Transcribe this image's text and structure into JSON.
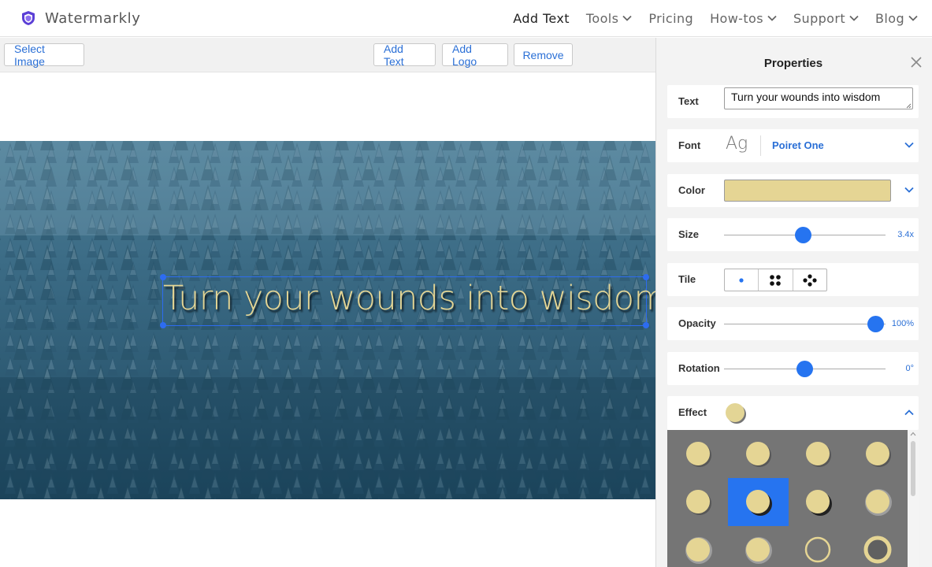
{
  "brand": {
    "name": "Watermarkly",
    "logo_icon": "shield-icon",
    "logo_color": "#5b3fd6"
  },
  "nav": {
    "items": [
      {
        "label": "Add Text",
        "dropdown": false,
        "active": true
      },
      {
        "label": "Tools",
        "dropdown": true,
        "active": false
      },
      {
        "label": "Pricing",
        "dropdown": false,
        "active": false
      },
      {
        "label": "How-tos",
        "dropdown": true,
        "active": false
      },
      {
        "label": "Support",
        "dropdown": true,
        "active": false
      },
      {
        "label": "Blog",
        "dropdown": true,
        "active": false
      }
    ]
  },
  "toolbar": {
    "select_image": "Select Image",
    "add_text": "Add Text",
    "add_logo": "Add Logo",
    "remove": "Remove"
  },
  "canvas": {
    "watermark_text": "Turn your wounds into wisdom",
    "watermark_color": "#e3d595"
  },
  "panel": {
    "title": "Properties",
    "text": {
      "label": "Text",
      "value": "Turn your wounds into wisdom"
    },
    "font": {
      "label": "Font",
      "sample": "Ag",
      "name": "Poiret One"
    },
    "color": {
      "label": "Color",
      "value": "#e5d594"
    },
    "size": {
      "label": "Size",
      "value_text": "3.4x",
      "fraction": 0.49
    },
    "tile": {
      "label": "Tile",
      "options": [
        "single-dot-icon",
        "four-dots-icon",
        "scattered-dots-icon"
      ],
      "selected": 0
    },
    "opacity": {
      "label": "Opacity",
      "value_text": "100%",
      "fraction": 0.94
    },
    "rotation": {
      "label": "Rotation",
      "value_text": "0°",
      "fraction": 0.5
    },
    "effect": {
      "label": "Effect",
      "expanded": true,
      "selected_index": 5
    }
  },
  "colors": {
    "accent": "#2674f0",
    "link": "#2a6fd6",
    "effect_bg": "#757575"
  }
}
